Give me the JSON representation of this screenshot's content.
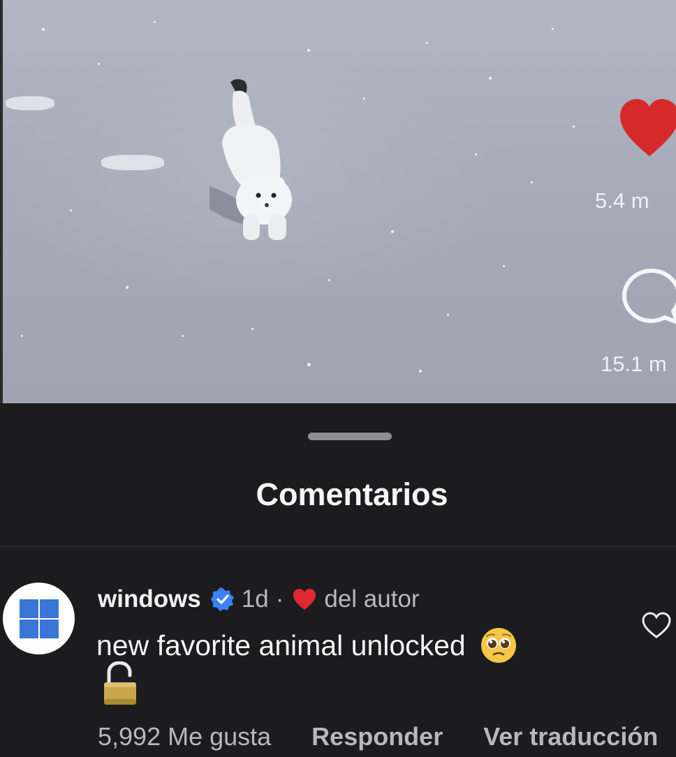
{
  "video": {
    "likes_count": "5.4 m",
    "comments_count": "15.1 m",
    "icons": {
      "like": "heart-filled-icon",
      "comment": "speech-bubble-icon"
    },
    "colors": {
      "like_heart": "#d62a2a"
    }
  },
  "sheet": {
    "title": "Comentarios"
  },
  "comment": {
    "username": "windows",
    "verified": true,
    "time": "1d",
    "separator": "·",
    "author_liked_label": "del autor",
    "text": "new favorite animal unlocked",
    "emojis": [
      "pleading-face-icon",
      "unlocked-padlock-icon"
    ],
    "likes_label": "5,992 Me gusta",
    "reply_label": "Responder",
    "translate_label": "Ver traducción",
    "colors": {
      "avatar_logo": "#3a76d6",
      "verified_badge": "#3b82f6"
    }
  }
}
